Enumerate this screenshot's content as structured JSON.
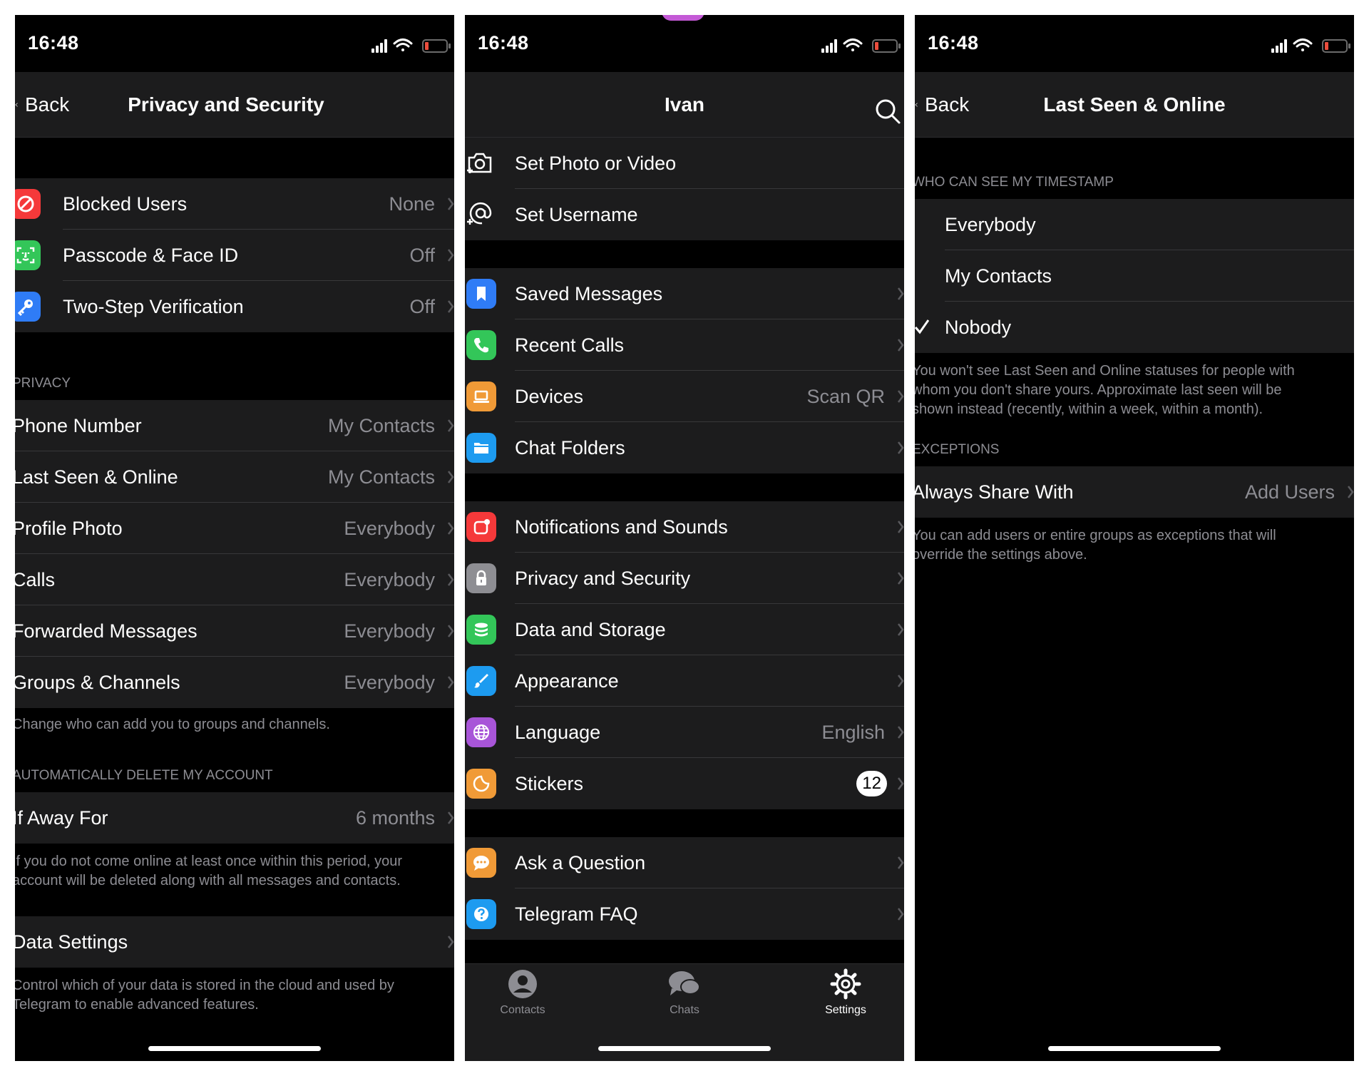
{
  "screen1": {
    "time": "16:48",
    "back_label": "Back",
    "title": "Privacy and Security",
    "security_items": [
      {
        "label": "Blocked Users",
        "value": "None"
      },
      {
        "label": "Passcode & Face ID",
        "value": "Off"
      },
      {
        "label": "Two-Step Verification",
        "value": "Off"
      }
    ],
    "privacy_header": "PRIVACY",
    "privacy_items": [
      {
        "label": "Phone Number",
        "value": "My Contacts"
      },
      {
        "label": "Last Seen & Online",
        "value": "My Contacts"
      },
      {
        "label": "Profile Photo",
        "value": "Everybody"
      },
      {
        "label": "Calls",
        "value": "Everybody"
      },
      {
        "label": "Forwarded Messages",
        "value": "Everybody"
      },
      {
        "label": "Groups & Channels",
        "value": "Everybody"
      }
    ],
    "privacy_footer": "Change who can add you to groups and channels.",
    "delete_header": "AUTOMATICALLY DELETE MY ACCOUNT",
    "away_label": "If Away For",
    "away_value": "6 months",
    "delete_footer": "If you do not come online at least once within this period, your\naccount will be deleted along with all messages and contacts.",
    "data_settings_label": "Data Settings",
    "data_footer": "Control which of your data is stored in the cloud and used by\nTelegram to enable advanced features."
  },
  "screen2": {
    "time": "16:48",
    "title": "Ivan",
    "profile_items": [
      {
        "label": "Set Photo or Video",
        "icon": "camera-icon"
      },
      {
        "label": "Set Username",
        "icon": "at-icon"
      }
    ],
    "group1": [
      {
        "label": "Saved Messages",
        "value": "",
        "icon": "bookmark-icon",
        "color": "#2f7cf6"
      },
      {
        "label": "Recent Calls",
        "value": "",
        "icon": "phone-icon",
        "color": "#33c659"
      },
      {
        "label": "Devices",
        "value": "Scan QR",
        "icon": "laptop-icon",
        "color": "#f09a37"
      },
      {
        "label": "Chat Folders",
        "value": "",
        "icon": "folder-icon",
        "color": "#1d9bf0"
      }
    ],
    "group2": [
      {
        "label": "Notifications and Sounds",
        "value": "",
        "icon": "bell-icon",
        "color": "#f5393a"
      },
      {
        "label": "Privacy and Security",
        "value": "",
        "icon": "lock-icon",
        "color": "#8e8e93"
      },
      {
        "label": "Data and Storage",
        "value": "",
        "icon": "database-icon",
        "color": "#33c659"
      },
      {
        "label": "Appearance",
        "value": "",
        "icon": "brush-icon",
        "color": "#1d9bf0"
      },
      {
        "label": "Language",
        "value": "English",
        "icon": "globe-icon",
        "color": "#a855d8"
      },
      {
        "label": "Stickers",
        "value": "",
        "badge": "12",
        "icon": "sticker-icon",
        "color": "#f09a37"
      }
    ],
    "group3": [
      {
        "label": "Ask a Question",
        "value": "",
        "icon": "chat-bubble-icon",
        "color": "#f09a37"
      },
      {
        "label": "Telegram FAQ",
        "value": "",
        "icon": "question-icon",
        "color": "#1d9bf0"
      }
    ],
    "tabs": [
      {
        "label": "Contacts",
        "icon": "person-icon"
      },
      {
        "label": "Chats",
        "icon": "chats-icon"
      },
      {
        "label": "Settings",
        "icon": "gear-icon"
      }
    ]
  },
  "screen3": {
    "time": "16:48",
    "back_label": "Back",
    "title": "Last Seen & Online",
    "timestamp_header": "WHO CAN SEE MY TIMESTAMP",
    "options": [
      "Everybody",
      "My Contacts",
      "Nobody"
    ],
    "selected_option": "Nobody",
    "timestamp_footer": "You won't see Last Seen and Online statuses for people with\nwhom you don't share yours. Approximate last seen will be\nshown instead (recently, within a week, within a month).",
    "exceptions_header": "EXCEPTIONS",
    "always_share_label": "Always Share With",
    "always_share_value": "Add Users",
    "exceptions_footer": "You can add users or entire groups as exceptions that will\noverride the settings above."
  },
  "colors": {
    "background": "#000000",
    "cell": "#1c1c1d",
    "secondary_text": "#8d8d93",
    "battery_low": "#eb4d3d"
  }
}
